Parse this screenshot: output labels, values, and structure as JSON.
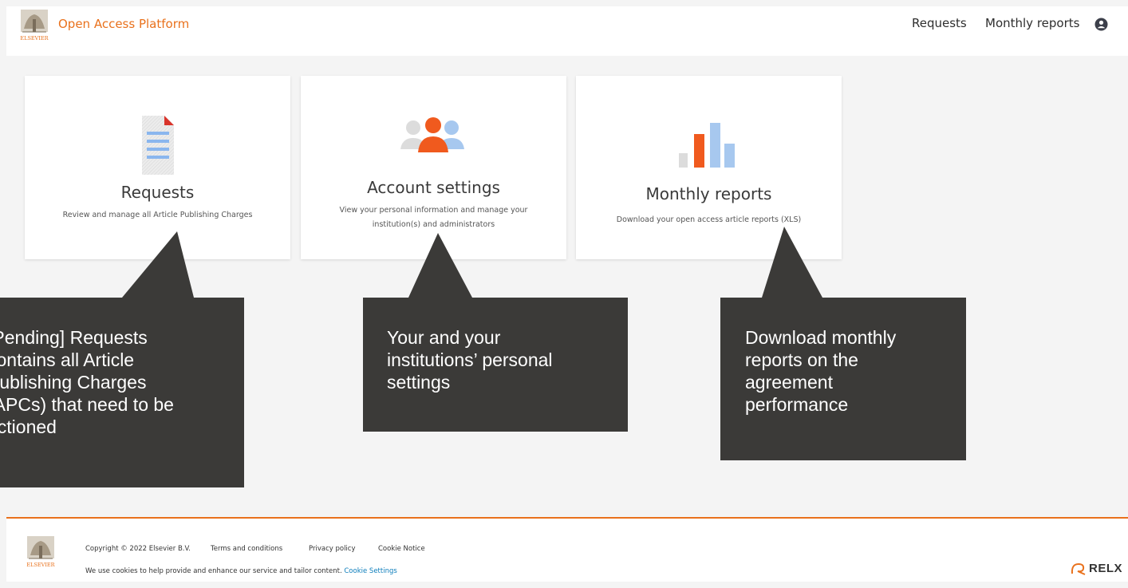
{
  "header": {
    "app_title": "Open Access Platform",
    "nav": [
      {
        "label": "Requests"
      },
      {
        "label": "Monthly reports"
      }
    ],
    "logo_text": "ELSEVIER"
  },
  "cards": [
    {
      "title": "Requests",
      "description": "Review and manage all Article Publishing Charges",
      "icon": "document-icon"
    },
    {
      "title": "Account settings",
      "description": "View your personal information and manage your institution(s) and administrators",
      "icon": "users-icon"
    },
    {
      "title": "Monthly reports",
      "description": "Download your open access article reports (XLS)",
      "icon": "bar-chart-icon"
    }
  ],
  "callouts": [
    {
      "text": "[Pending] Requests\ncontains all Article\nPublishing Charges\n(APCs) that need to be\nactioned"
    },
    {
      "text": "Your and your\ninstitutions’ personal\nsettings"
    },
    {
      "text": "Download monthly\nreports on the\nagreement\nperformance"
    }
  ],
  "footer": {
    "copyright": "Copyright © 2022 Elsevier B.V.",
    "links": [
      "Terms and conditions",
      "Privacy policy",
      "Cookie Notice"
    ],
    "cookies_text": "We use cookies to help provide and enhance our service and tailor content. ",
    "cookie_settings": "Cookie Settings",
    "logo_text": "ELSEVIER",
    "relx": "RELX"
  },
  "colors": {
    "accent": "#e9711c",
    "callout_bg": "#3b3a38",
    "link_blue": "#0c7dbb",
    "chart_blue": "#a7c8ef"
  }
}
